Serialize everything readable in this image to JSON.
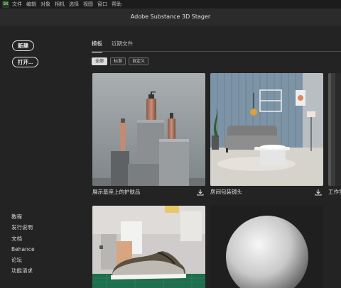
{
  "menubar": {
    "app_icon": "St",
    "items": [
      "文件",
      "编辑",
      "对象",
      "相机",
      "选择",
      "视图",
      "窗口",
      "帮助"
    ]
  },
  "header": {
    "title": "Adobe Substance 3D Stager"
  },
  "sidebar": {
    "new_label": "新建",
    "open_label": "打开...",
    "links": [
      "教程",
      "发行说明",
      "文档",
      "Behance",
      "论坛",
      "功能请求"
    ]
  },
  "main": {
    "tabs": [
      {
        "label": "模板",
        "active": true
      },
      {
        "label": "近期文件",
        "active": false
      }
    ],
    "filters": [
      {
        "label": "全部",
        "active": true
      },
      {
        "label": "标准",
        "active": false
      },
      {
        "label": "自定义",
        "active": false
      }
    ],
    "templates": [
      {
        "label": "展示基座上的护肤品",
        "icon": "download-icon"
      },
      {
        "label": "房间包装镜头",
        "icon": "download-icon"
      },
      {
        "label": "工作室",
        "icon": "download-icon"
      },
      {
        "label": "",
        "icon": ""
      },
      {
        "label": "",
        "icon": ""
      }
    ]
  }
}
